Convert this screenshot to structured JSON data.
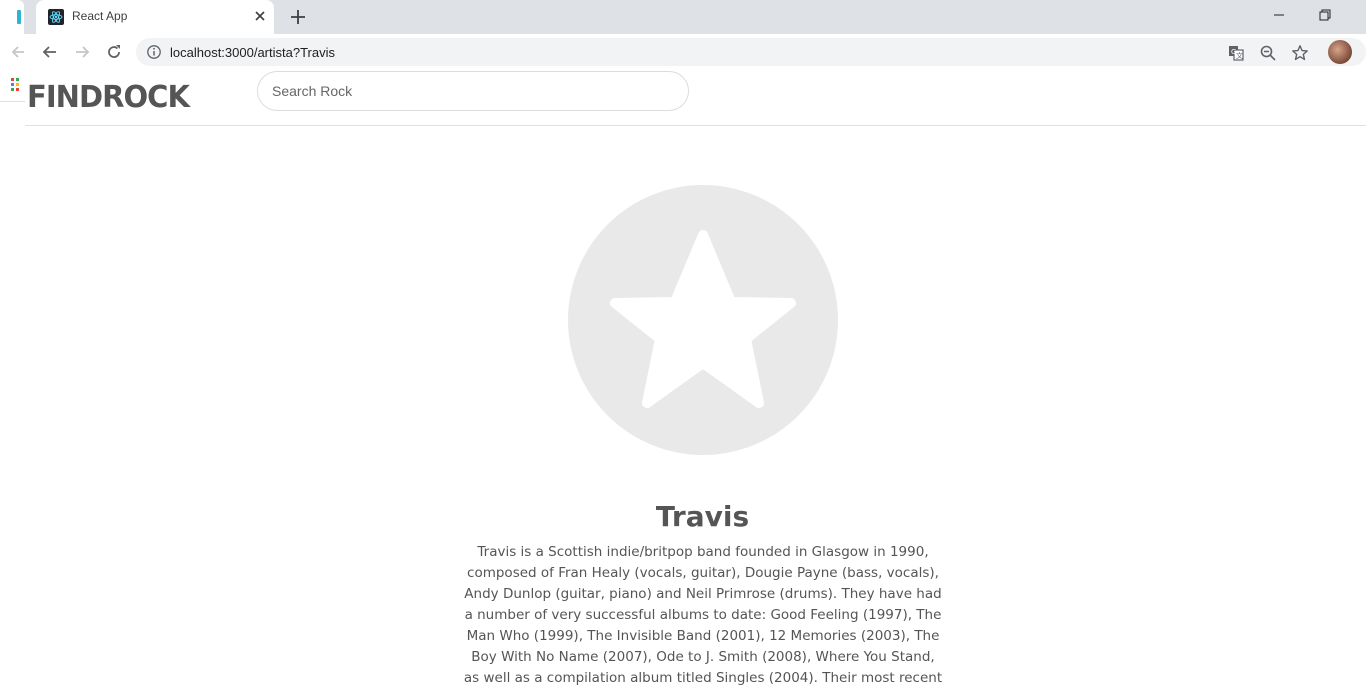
{
  "browser": {
    "tab_title": "React App",
    "url": "localhost:3000/artista?Travis"
  },
  "header": {
    "logo_text": "FINDROCK",
    "search_placeholder": "Search Rock"
  },
  "artist": {
    "name": "Travis",
    "bio": "Travis is a Scottish indie/britpop band founded in Glasgow in 1990, composed of Fran Healy (vocals, guitar), Dougie Payne (bass, vocals), Andy Dunlop (guitar, piano) and Neil Primrose (drums). They have had a number of very successful albums to date: Good Feeling (1997), The Man Who (1999), The Invisible Band (2001), 12 Memories (2003), The Boy With No Name (2007), Ode to J. Smith (2008), Where You Stand, as well as a compilation album titled Singles (2004). Their most recent album is"
  },
  "colors": {
    "logo": "#555555",
    "avatar_bg": "#e9e9e9",
    "text": "#555555"
  }
}
